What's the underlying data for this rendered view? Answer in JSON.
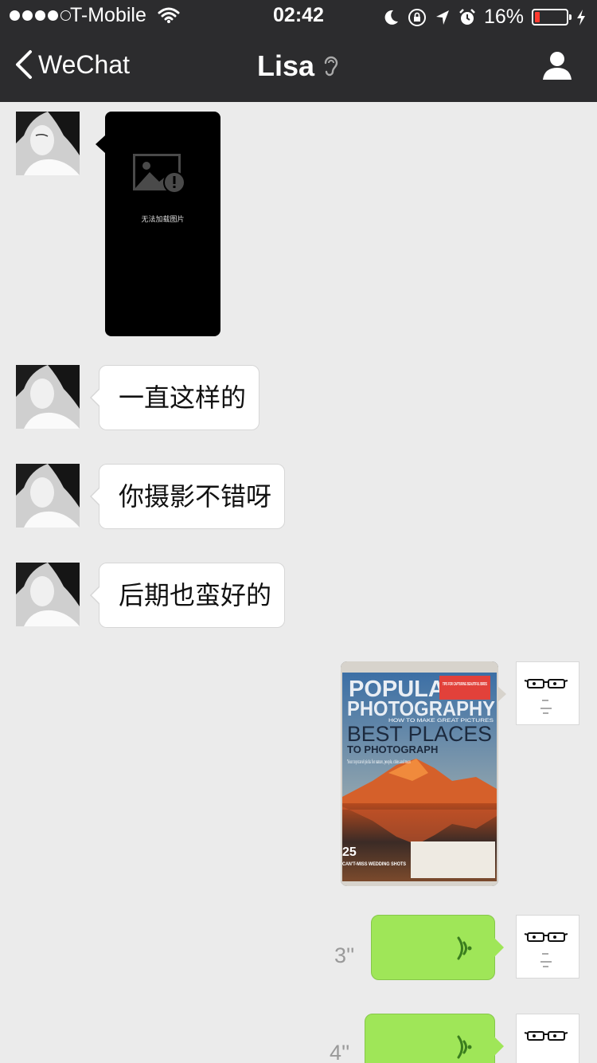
{
  "status_bar": {
    "carrier": "T-Mobile",
    "time": "02:42",
    "battery_percent": "16%",
    "battery_level": 0.16,
    "signal_bars_filled": 4,
    "signal_bars_total": 5
  },
  "nav": {
    "back_label": "WeChat",
    "title": "Lisa"
  },
  "messages": {
    "image_failed_text": "无法加载图片",
    "text_1": "一直这样的",
    "text_2": "你摄影不错呀",
    "text_3": "后期也蛮好的",
    "magazine": {
      "title_top": "POPULAR",
      "title_bottom": "PHOTOGRAPHY",
      "tag": "TIPS FOR CAPTURING BEAUTIFUL BIRDS",
      "strap": "HOW TO MAKE GREAT PICTURES",
      "headline": "BEST PLACES",
      "subhead": "TO PHOTOGRAPH",
      "blurb": "Your top travel picks for nature, people, cities and more",
      "corner_number": "25",
      "corner_text": "CAN'T-MISS WEDDING SHOTS"
    },
    "voice_1_duration": "3''",
    "voice_2_duration": "4''"
  },
  "colors": {
    "nav_background": "#2c2c2e",
    "chat_background": "#ebebeb",
    "voice_bubble": "#9fe658",
    "battery_low": "#ff3b30"
  }
}
